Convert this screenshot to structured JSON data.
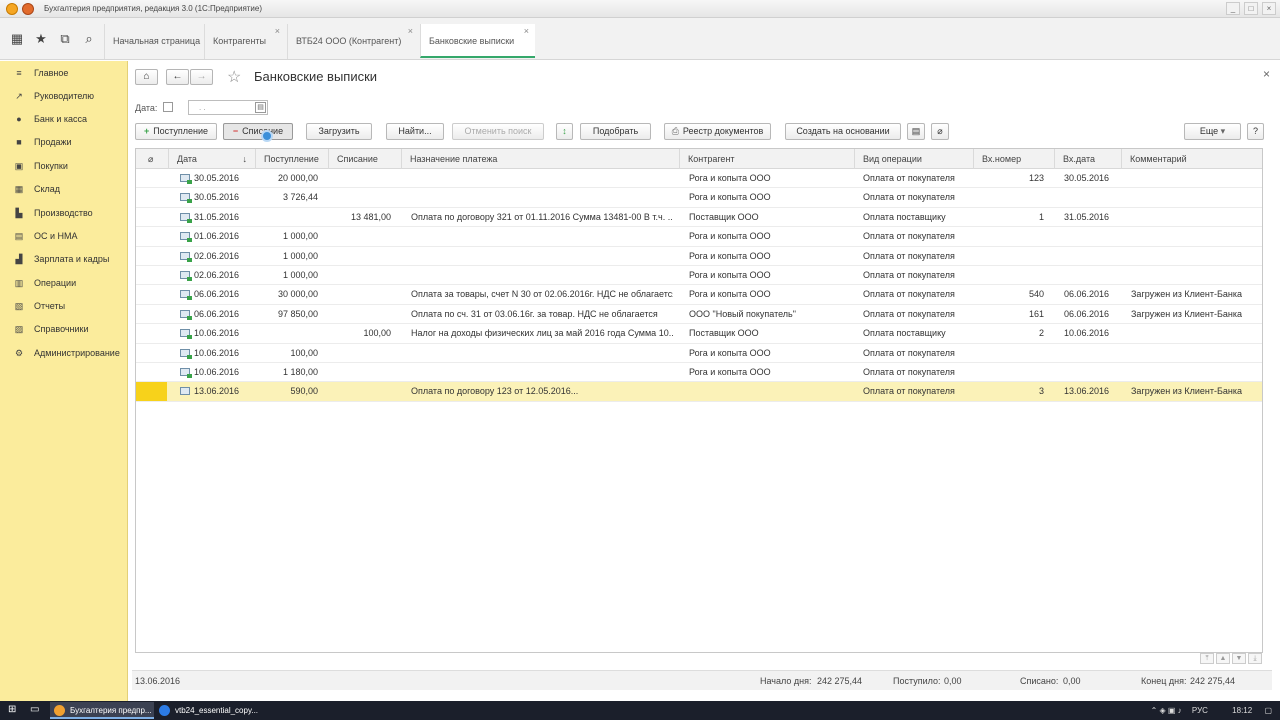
{
  "window": {
    "title": "Бухгалтерия предприятия, редакция 3.0  (1С:Предприятие)"
  },
  "topbar": {
    "icons": [
      "apps-grid-icon",
      "star-icon",
      "history-icon",
      "search-icon"
    ],
    "tabs": [
      {
        "label": "Начальная страница",
        "closable": false,
        "active": false
      },
      {
        "label": "Контрагенты",
        "closable": true,
        "active": false
      },
      {
        "label": "ВТБ24 ООО (Контрагент)",
        "closable": true,
        "active": false
      },
      {
        "label": "Банковские выписки",
        "closable": true,
        "active": true
      }
    ]
  },
  "sidebar": {
    "items": [
      {
        "label": "Главное",
        "icon": "menu-icon"
      },
      {
        "label": "Руководителю",
        "icon": "chart-trend-icon"
      },
      {
        "label": "Банк и касса",
        "icon": "bank-icon"
      },
      {
        "label": "Продажи",
        "icon": "cart-icon"
      },
      {
        "label": "Покупки",
        "icon": "basket-icon"
      },
      {
        "label": "Склад",
        "icon": "warehouse-icon"
      },
      {
        "label": "Производство",
        "icon": "factory-icon"
      },
      {
        "label": "ОС и НМА",
        "icon": "assets-icon"
      },
      {
        "label": "Зарплата и кадры",
        "icon": "people-icon"
      },
      {
        "label": "Операции",
        "icon": "operations-icon"
      },
      {
        "label": "Отчеты",
        "icon": "reports-icon"
      },
      {
        "label": "Справочники",
        "icon": "books-icon"
      },
      {
        "label": "Администрирование",
        "icon": "gear-icon"
      }
    ]
  },
  "page": {
    "title": "Банковские выписки",
    "date_filter": {
      "label": "Дата:",
      "placeholder": " .  . "
    }
  },
  "toolbar": {
    "receipt": "Поступление",
    "writeoff": "Списание",
    "load": "Загрузить",
    "find": "Найти...",
    "cancel_search": "Отменить поиск",
    "pick": "Подобрать",
    "registry": "Реестр документов",
    "create_based": "Создать на основании",
    "more": "Еще",
    "help": "?"
  },
  "table": {
    "columns": {
      "attach": "",
      "date": "Дата",
      "receipt": "Поступление",
      "writeoff": "Списание",
      "purpose": "Назначение платежа",
      "counterparty": "Контрагент",
      "operation": "Вид операции",
      "in_number": "Вх.номер",
      "in_date": "Вх.дата",
      "comment": "Комментарий"
    },
    "sort_indicator": "↓",
    "rows": [
      {
        "date": "30.05.2016",
        "receipt": "20 000,00",
        "writeoff": "",
        "purpose": "",
        "counterparty": "Рога и копыта ООО",
        "operation": "Оплата от покупателя",
        "in_number": "123",
        "in_date": "30.05.2016",
        "comment": ""
      },
      {
        "date": "30.05.2016",
        "receipt": "3 726,44",
        "writeoff": "",
        "purpose": "",
        "counterparty": "Рога и копыта ООО",
        "operation": "Оплата от покупателя",
        "in_number": "",
        "in_date": "",
        "comment": ""
      },
      {
        "date": "31.05.2016",
        "receipt": "",
        "writeoff": "13 481,00",
        "purpose": "Оплата по договору 321 от 01.11.2016 Сумма 13481-00 В т.ч. ...",
        "counterparty": "Поставщик ООО",
        "operation": "Оплата поставщику",
        "in_number": "1",
        "in_date": "31.05.2016",
        "comment": ""
      },
      {
        "date": "01.06.2016",
        "receipt": "1 000,00",
        "writeoff": "",
        "purpose": "",
        "counterparty": "Рога и копыта ООО",
        "operation": "Оплата от покупателя",
        "in_number": "",
        "in_date": "",
        "comment": ""
      },
      {
        "date": "02.06.2016",
        "receipt": "1 000,00",
        "writeoff": "",
        "purpose": "",
        "counterparty": "Рога и копыта ООО",
        "operation": "Оплата от покупателя",
        "in_number": "",
        "in_date": "",
        "comment": ""
      },
      {
        "date": "02.06.2016",
        "receipt": "1 000,00",
        "writeoff": "",
        "purpose": "",
        "counterparty": "Рога и копыта ООО",
        "operation": "Оплата от покупателя",
        "in_number": "",
        "in_date": "",
        "comment": ""
      },
      {
        "date": "06.06.2016",
        "receipt": "30 000,00",
        "writeoff": "",
        "purpose": "Оплата за товары, счет N 30 от 02.06.2016г. НДС не облагается.",
        "counterparty": "Рога и копыта ООО",
        "operation": "Оплата от покупателя",
        "in_number": "540",
        "in_date": "06.06.2016",
        "comment": "Загружен из Клиент-Банка"
      },
      {
        "date": "06.06.2016",
        "receipt": "97 850,00",
        "writeoff": "",
        "purpose": "Оплата по сч. 31 от 03.06.16г. за товар. НДС не облагается",
        "counterparty": "ООО \"Новый покупатель\"",
        "operation": "Оплата от покупателя",
        "in_number": "161",
        "in_date": "06.06.2016",
        "comment": "Загружен из Клиент-Банка"
      },
      {
        "date": "10.06.2016",
        "receipt": "",
        "writeoff": "100,00",
        "purpose": "Налог на доходы физических лиц за май 2016 года Сумма 10...",
        "counterparty": "Поставщик ООО",
        "operation": "Оплата поставщику",
        "in_number": "2",
        "in_date": "10.06.2016",
        "comment": ""
      },
      {
        "date": "10.06.2016",
        "receipt": "100,00",
        "writeoff": "",
        "purpose": "",
        "counterparty": "Рога и копыта ООО",
        "operation": "Оплата от покупателя",
        "in_number": "",
        "in_date": "",
        "comment": ""
      },
      {
        "date": "10.06.2016",
        "receipt": "1 180,00",
        "writeoff": "",
        "purpose": "",
        "counterparty": "Рога и копыта ООО",
        "operation": "Оплата от покупателя",
        "in_number": "",
        "in_date": "",
        "comment": ""
      },
      {
        "date": "13.06.2016",
        "receipt": "590,00",
        "writeoff": "",
        "purpose": "Оплата по договору 123 от 12.05.2016...",
        "counterparty": "",
        "operation": "Оплата от покупателя",
        "in_number": "3",
        "in_date": "13.06.2016",
        "comment": "Загружен из Клиент-Банка",
        "selected": true
      }
    ]
  },
  "footer": {
    "current_date": "13.06.2016",
    "start_label": "Начало дня:",
    "start_value": "242 275,44",
    "received_label": "Поступило:",
    "received_value": "0,00",
    "written_label": "Списано:",
    "written_value": "0,00",
    "end_label": "Конец дня:",
    "end_value": "242 275,44"
  },
  "taskbar": {
    "apps": [
      {
        "label": "Бухгалтерия предпр...",
        "active": true
      },
      {
        "label": "vtb24_essential_copy...",
        "active": false
      }
    ],
    "language": "РУС",
    "time": "18:12"
  }
}
